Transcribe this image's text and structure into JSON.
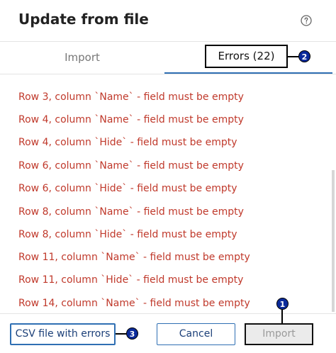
{
  "dialog": {
    "title": "Update from file",
    "help_icon": "help-circle-icon"
  },
  "tabs": [
    {
      "label": "Import",
      "active": false
    },
    {
      "label": "Errors (22)",
      "active": true
    }
  ],
  "errors": [
    "Row 3, column `Name` - field must be empty",
    "Row 4, column `Name` - field must be empty",
    "Row 4, column `Hide` - field must be empty",
    "Row 6, column `Name` - field must be empty",
    "Row 6, column `Hide` - field must be empty",
    "Row 8, column `Name` - field must be empty",
    "Row 8, column `Hide` - field must be empty",
    "Row 11, column `Name` - field must be empty",
    "Row 11, column `Hide` - field must be empty",
    "Row 14, column `Name` - field must be empty"
  ],
  "footer": {
    "csv_button": "CSV file with errors",
    "cancel_button": "Cancel",
    "import_button": "Import"
  },
  "markers": [
    "1",
    "2",
    "3"
  ],
  "colors": {
    "error_text": "#c0392b",
    "accent": "#2f6fb3",
    "marker": "#0a2a9a"
  }
}
